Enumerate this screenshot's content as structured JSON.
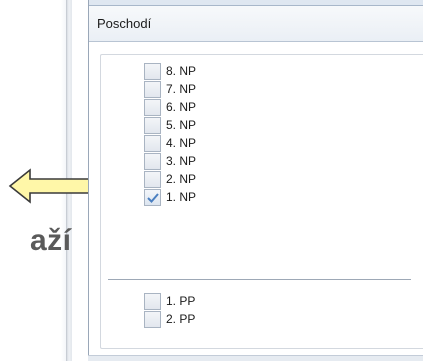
{
  "panel": {
    "title": "Poschodí"
  },
  "floors_above": [
    {
      "label": "8. NP",
      "checked": false
    },
    {
      "label": "7. NP",
      "checked": false
    },
    {
      "label": "6. NP",
      "checked": false
    },
    {
      "label": "5. NP",
      "checked": false
    },
    {
      "label": "4. NP",
      "checked": false
    },
    {
      "label": "3. NP",
      "checked": false
    },
    {
      "label": "2. NP",
      "checked": false
    },
    {
      "label": "1. NP",
      "checked": true
    }
  ],
  "floors_below": [
    {
      "label": "1. PP",
      "checked": false
    },
    {
      "label": "2. PP",
      "checked": false
    }
  ],
  "overlay": {
    "partial_text": "aží",
    "arrow_color": "#fff7a8",
    "arrow_stroke": "#3a3a3a"
  },
  "colors": {
    "checkmark": "#4a7fc1",
    "panel_border": "#9aa7b8"
  }
}
